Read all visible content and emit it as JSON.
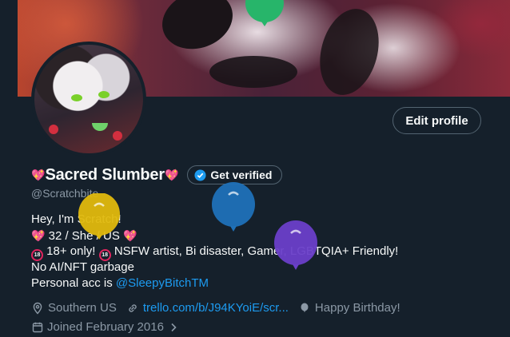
{
  "profile": {
    "name": "Sacred Slumber",
    "handle": "@Scratchbite",
    "edit_label": "Edit profile",
    "verify_label": "Get verified"
  },
  "bio": {
    "line1": "Hey, I'm Scratch!",
    "line2": "32 / She / US",
    "line3_a": "18+ only!",
    "line3_b": "NSFW artist, Bi disaster, Gamer, LGBTQIA+ Friendly!",
    "line4": "No AI/NFT garbage",
    "line5_prefix": "Personal acc is ",
    "line5_mention": "@SleepyBitchTM",
    "age_badge": "18"
  },
  "meta": {
    "location": "Southern US",
    "website": "trello.com/b/J94KYoiE/scr...",
    "birthday": "Happy Birthday!",
    "joined": "Joined February 2016"
  },
  "icons": {
    "location": "location-pin-icon",
    "link": "link-icon",
    "birthday": "balloon-icon",
    "calendar": "calendar-icon",
    "verified": "verified-badge-icon"
  },
  "colors": {
    "background": "#15202b",
    "accent": "#1d9bf0",
    "muted": "#8b98a5",
    "balloon_yellow": "#e0b90d",
    "balloon_blue": "#1f71b8",
    "balloon_purple": "#6a3fc9",
    "balloon_green": "#27b56a"
  }
}
